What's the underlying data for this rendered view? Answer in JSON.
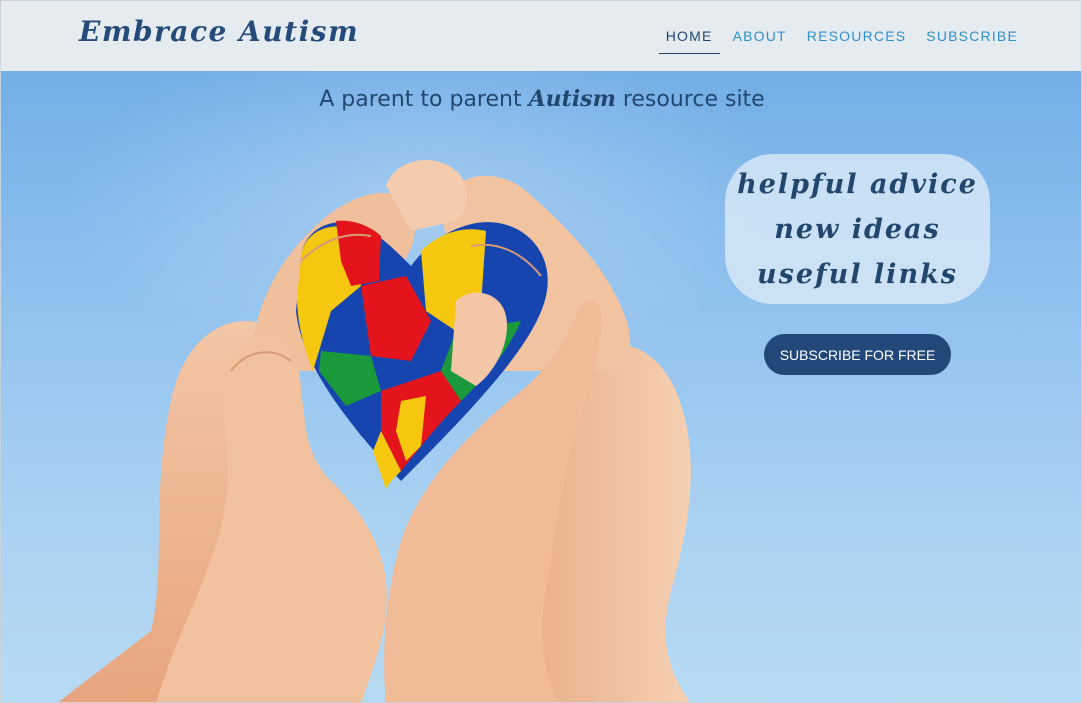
{
  "header": {
    "brand": "Embrace Autism",
    "nav": [
      {
        "label": "HOME",
        "active": true
      },
      {
        "label": "ABOUT",
        "active": false
      },
      {
        "label": "RESOURCES",
        "active": false
      },
      {
        "label": "SUBSCRIBE",
        "active": false
      }
    ]
  },
  "hero": {
    "tagline_before": "A parent to parent ",
    "tagline_emphasis": "Autism",
    "tagline_after": " resource site",
    "bubble_lines": [
      "helpful advice",
      "new ideas",
      "useful links"
    ],
    "cta_label": "SUBSCRIBE FOR FREE",
    "image_subject": "cupped hands holding puzzle-piece heart"
  },
  "colors": {
    "header_bg": "#e6ebf0",
    "brand": "#244b79",
    "nav_link": "#2f8fcf",
    "nav_active": "#22476f",
    "sky": "#8fc1ee",
    "button_bg": "#22487a",
    "puzzle": [
      "#e3141b",
      "#1745b0",
      "#f5c80f",
      "#1b9a3b"
    ]
  }
}
